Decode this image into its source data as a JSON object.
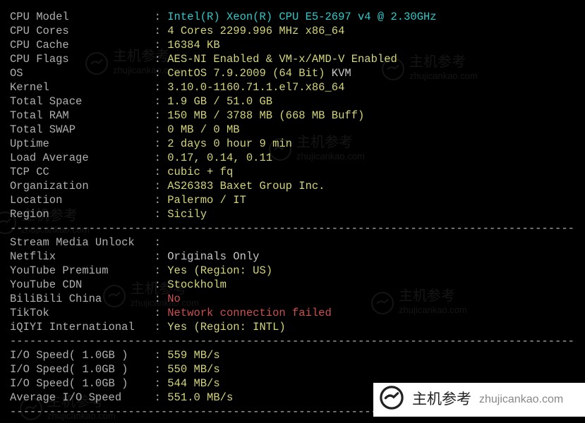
{
  "dash": "--------------------------------------------------------------------------------------",
  "sysinfo": [
    {
      "label": "CPU Model",
      "value": "Intel(R) Xeon(R) CPU E5-2697 v4 @ 2.30GHz",
      "color": "teal"
    },
    {
      "label": "CPU Cores",
      "value": "4 Cores 2299.996 MHz x86_64",
      "color": "yellow"
    },
    {
      "label": "CPU Cache",
      "value": "16384 KB",
      "color": "yellow"
    },
    {
      "label": "CPU Flags",
      "value": "AES-NI Enabled & VM-x/AMD-V Enabled",
      "color": "yellow"
    },
    {
      "label": "OS",
      "value": "CentOS 7.9.2009 (64 Bit)",
      "color": "yellow",
      "extra": " KVM",
      "extraColor": "white"
    },
    {
      "label": "Kernel",
      "value": "3.10.0-1160.71.1.el7.x86_64",
      "color": "yellow"
    },
    {
      "label": "Total Space",
      "value": "1.9 GB / 51.0 GB",
      "color": "yellow"
    },
    {
      "label": "Total RAM",
      "value": "150 MB / 3788 MB (668 MB Buff)",
      "color": "yellow"
    },
    {
      "label": "Total SWAP",
      "value": "0 MB / 0 MB",
      "color": "yellow"
    },
    {
      "label": "Uptime",
      "value": "2 days 0 hour 9 min",
      "color": "yellow"
    },
    {
      "label": "Load Average",
      "value": "0.17, 0.14, 0.11",
      "color": "yellow"
    },
    {
      "label": "TCP CC",
      "value": "cubic + fq",
      "color": "yellow"
    },
    {
      "label": "Organization",
      "value": "AS26383 Baxet Group Inc.",
      "color": "yellow"
    },
    {
      "label": "Location",
      "value": "Palermo / IT",
      "color": "yellow"
    },
    {
      "label": "Region",
      "value": "Sicily",
      "color": "yellow"
    }
  ],
  "stream": [
    {
      "label": "Stream Media Unlock",
      "value": "",
      "color": "white"
    },
    {
      "label": "Netflix",
      "value": "Originals Only",
      "color": "white"
    },
    {
      "label": "YouTube Premium",
      "value": "Yes (Region: US)",
      "color": "yellow"
    },
    {
      "label": "YouTube CDN",
      "value": "Stockholm",
      "color": "yellow"
    },
    {
      "label": "BiliBili China",
      "value": "No",
      "color": "red"
    },
    {
      "label": "TikTok",
      "value": "Network connection failed",
      "color": "red"
    },
    {
      "label": "iQIYI International",
      "value": "Yes (Region: INTL)",
      "color": "yellow"
    }
  ],
  "io": [
    {
      "label": "I/O Speed( 1.0GB )",
      "value": "559 MB/s",
      "color": "yellow"
    },
    {
      "label": "I/O Speed( 1.0GB )",
      "value": "550 MB/s",
      "color": "yellow"
    },
    {
      "label": "I/O Speed( 1.0GB )",
      "value": "544 MB/s",
      "color": "yellow"
    },
    {
      "label": "Average I/O Speed",
      "value": "551.0 MB/s",
      "color": "yellow"
    }
  ],
  "watermark": {
    "cn": "主机参考",
    "url": "zhujicankao.com"
  },
  "banner": {
    "cn": "主机参考",
    "url": "zhujicankao.com"
  }
}
